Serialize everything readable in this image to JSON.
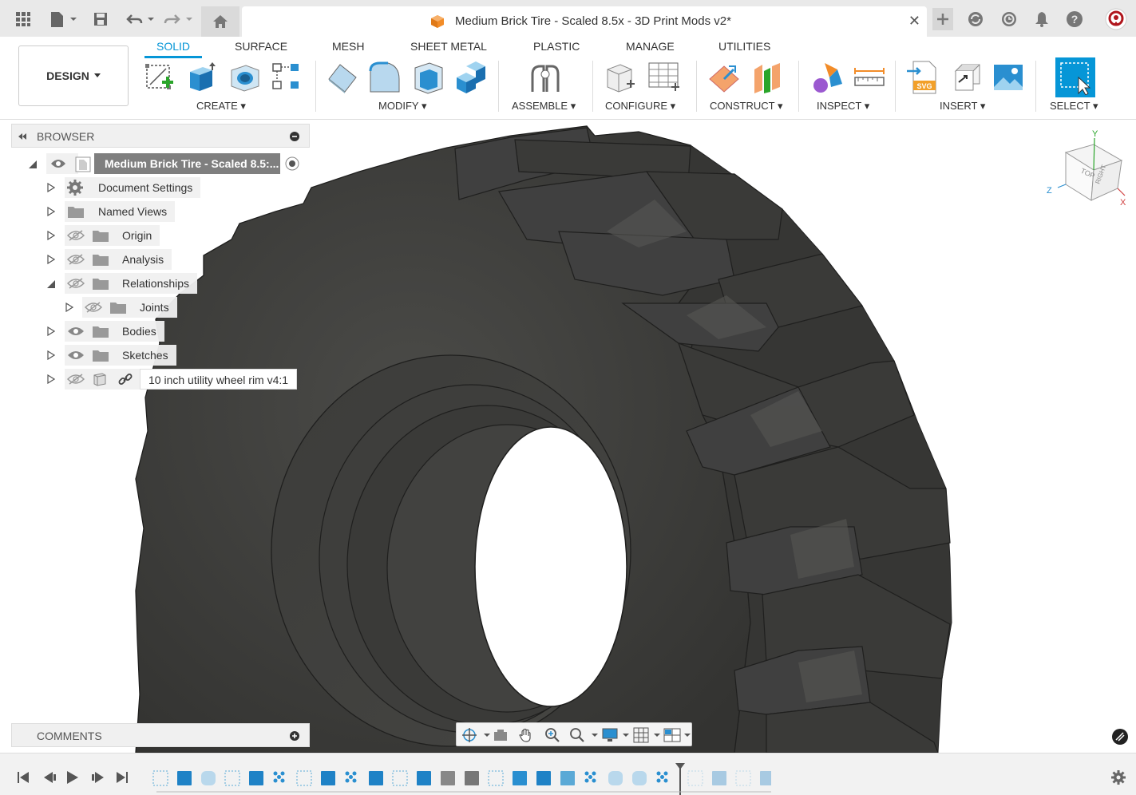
{
  "window": {
    "document_title": "Medium Brick Tire - Scaled 8.5x - 3D Print Mods v2*",
    "close_glyph": "✕"
  },
  "toolbar": {
    "workspace": "DESIGN",
    "tabs": [
      "SOLID",
      "SURFACE",
      "MESH",
      "SHEET METAL",
      "PLASTIC",
      "MANAGE",
      "UTILITIES"
    ],
    "active_tab": "SOLID",
    "groups": [
      "CREATE",
      "MODIFY",
      "ASSEMBLE",
      "CONFIGURE",
      "CONSTRUCT",
      "INSPECT",
      "INSERT",
      "SELECT"
    ],
    "accent_color": "#0696d7"
  },
  "browser": {
    "title": "BROWSER",
    "root": "Medium Brick Tire - Scaled 8.5:...",
    "items": [
      {
        "label": "Document Settings",
        "icon": "gear-icon",
        "visibility": "none"
      },
      {
        "label": "Named Views",
        "icon": "folder-icon",
        "visibility": "none"
      },
      {
        "label": "Origin",
        "icon": "folder-icon",
        "visibility": "hidden"
      },
      {
        "label": "Analysis",
        "icon": "folder-icon",
        "visibility": "hidden"
      },
      {
        "label": "Relationships",
        "icon": "folder-icon",
        "visibility": "hidden",
        "expanded": true
      },
      {
        "label": "Joints",
        "icon": "folder-icon",
        "visibility": "hidden"
      },
      {
        "label": "Bodies",
        "icon": "folder-icon",
        "visibility": "visible"
      },
      {
        "label": "Sketches",
        "icon": "folder-icon",
        "visibility": "visible"
      },
      {
        "label": "10 inch utility wheel rim v4:1",
        "icon": "component-icon",
        "visibility": "hidden",
        "linked": true
      }
    ]
  },
  "comments": {
    "title": "COMMENTS"
  },
  "viewcube": {
    "faces": [
      "TOP",
      "RIGHT"
    ],
    "axes": [
      "Y",
      "Z",
      "X"
    ]
  },
  "colors": {
    "tire": "#3d3d3b",
    "tire_light": "#4a4a47",
    "brand_orange": "#f28c28"
  }
}
